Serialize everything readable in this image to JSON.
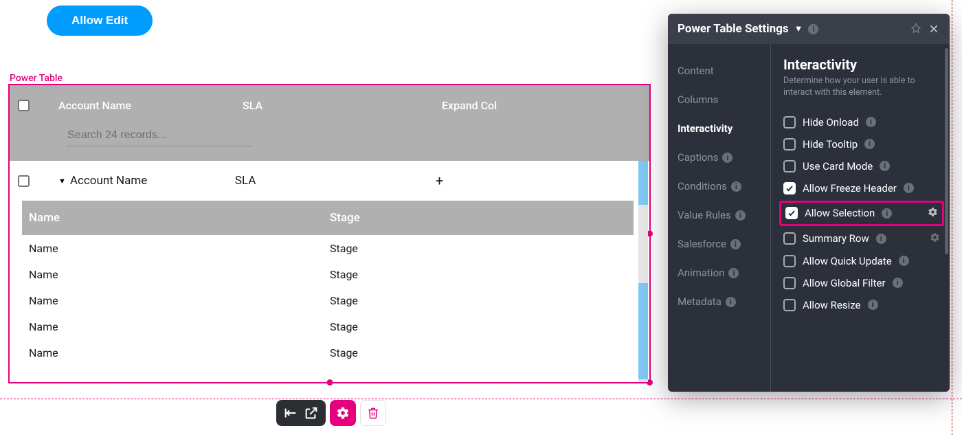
{
  "buttons": {
    "allow_edit": "Allow Edit"
  },
  "component": {
    "label": "Power Table"
  },
  "table": {
    "headers": {
      "account_name": "Account Name",
      "sla": "SLA",
      "expand": "Expand Col"
    },
    "search_placeholder": "Search 24 records...",
    "row": {
      "account_name": "Account Name",
      "sla": "SLA",
      "expand_glyph": "+"
    },
    "nested": {
      "headers": {
        "name": "Name",
        "stage": "Stage"
      },
      "rows": [
        {
          "name": "Name",
          "stage": "Stage"
        },
        {
          "name": "Name",
          "stage": "Stage"
        },
        {
          "name": "Name",
          "stage": "Stage"
        },
        {
          "name": "Name",
          "stage": "Stage"
        },
        {
          "name": "Name",
          "stage": "Stage"
        }
      ]
    }
  },
  "settings": {
    "title": "Power Table Settings",
    "nav": {
      "content": "Content",
      "columns": "Columns",
      "interactivity": "Interactivity",
      "captions": "Captions",
      "conditions": "Conditions",
      "value_rules": "Value Rules",
      "salesforce": "Salesforce",
      "animation": "Animation",
      "metadata": "Metadata"
    },
    "section": {
      "title": "Interactivity",
      "subtitle": "Determine how your user is able to interact with this element."
    },
    "options": {
      "hide_onload": "Hide Onload",
      "hide_tooltip": "Hide Tooltip",
      "use_card_mode": "Use Card Mode",
      "allow_freeze_header": "Allow Freeze Header",
      "allow_selection": "Allow Selection",
      "summary_row": "Summary Row",
      "allow_quick_update": "Allow Quick Update",
      "allow_global_filter": "Allow Global Filter",
      "allow_resize": "Allow Resize"
    }
  }
}
